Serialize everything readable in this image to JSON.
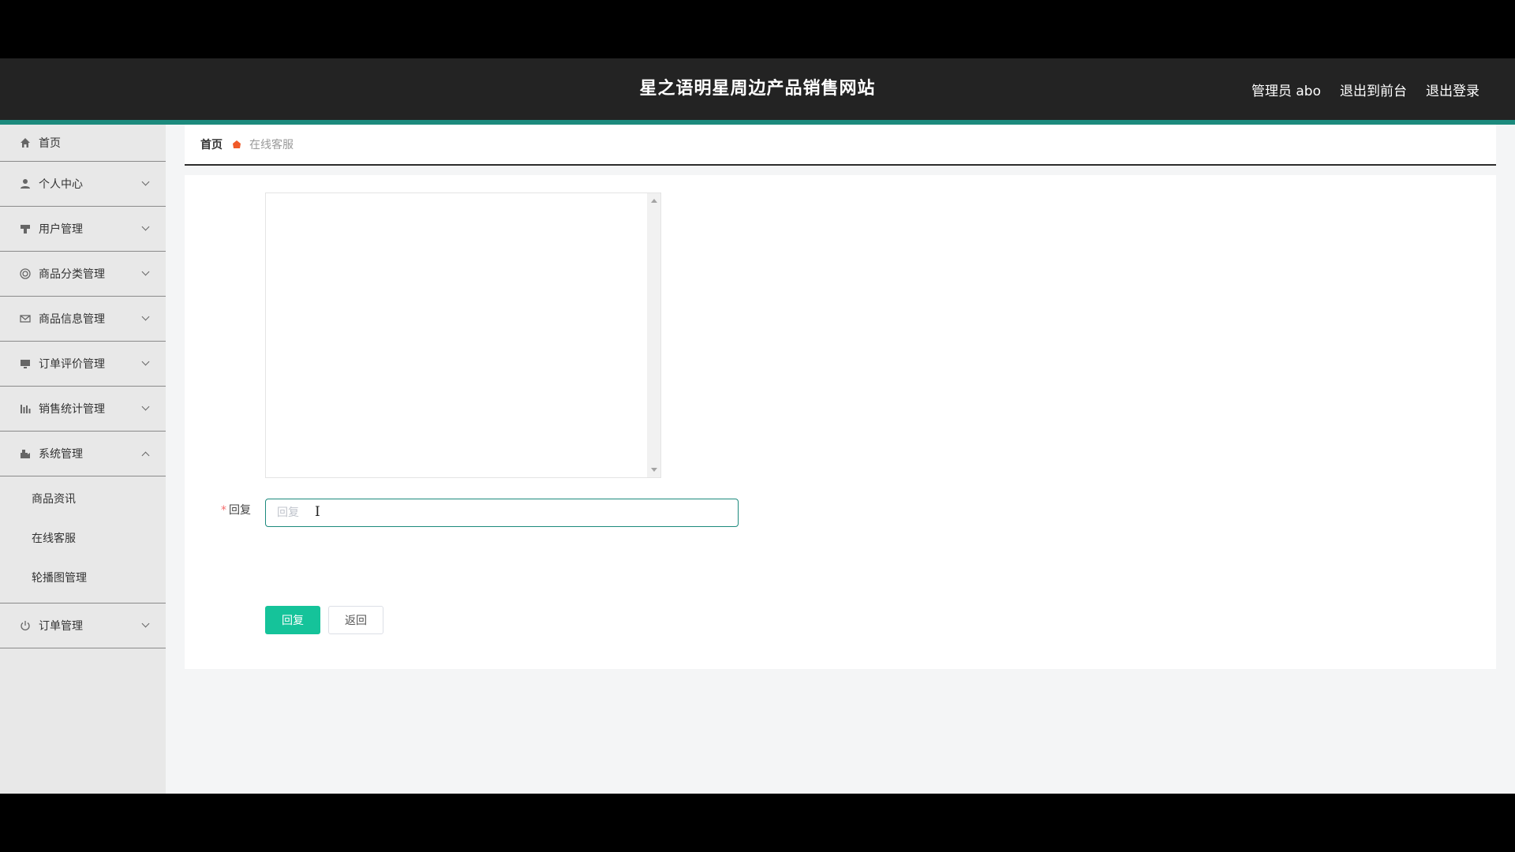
{
  "header": {
    "title": "星之语明星周边产品销售网站",
    "user_label": "管理员 abo",
    "front_label": "退出到前台",
    "logout_label": "退出登录"
  },
  "sidebar": {
    "items": [
      {
        "label": "首页",
        "icon": "home-icon"
      },
      {
        "label": "个人中心",
        "icon": "user-icon"
      },
      {
        "label": "用户管理",
        "icon": "users-icon"
      },
      {
        "label": "商品分类管理",
        "icon": "category-icon"
      },
      {
        "label": "商品信息管理",
        "icon": "envelope-icon"
      },
      {
        "label": "订单评价管理",
        "icon": "monitor-icon"
      },
      {
        "label": "销售统计管理",
        "icon": "bar-chart-icon"
      },
      {
        "label": "系统管理",
        "icon": "system-icon"
      },
      {
        "label": "订单管理",
        "icon": "power-icon"
      }
    ],
    "system_sub": [
      "商品资讯",
      "在线客服",
      "轮播图管理"
    ]
  },
  "breadcrumb": {
    "home": "首页",
    "current": "在线客服"
  },
  "form": {
    "reply_label": "回复",
    "reply_placeholder": "回复",
    "reply_value": "",
    "submit_label": "回复",
    "back_label": "返回"
  },
  "colors": {
    "header_bg": "#232323",
    "accent_bar": "#1c8a7d",
    "primary_button": "#15c39a",
    "breadcrumb_icon": "#f05a28"
  }
}
